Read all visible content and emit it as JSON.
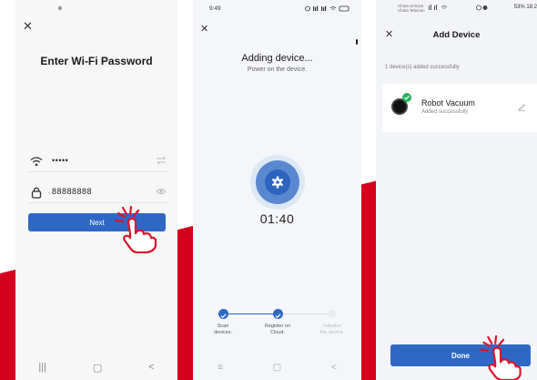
{
  "screen1": {
    "title": "Enter Wi-Fi Password",
    "wifi_value": "•••••",
    "password_value": "88888888",
    "next_label": "Next",
    "nav": [
      "|||",
      "▢",
      "<"
    ]
  },
  "screen2": {
    "time": "9:49",
    "title": "Adding device...",
    "subtitle": "Power on the device.",
    "timer": "01:40",
    "steps": [
      {
        "label_line1": "Scan",
        "label_line2": "devices.",
        "state": "done"
      },
      {
        "label_line1": "Register on",
        "label_line2": "Cloud.",
        "state": "done"
      },
      {
        "label_line1": "Initialize",
        "label_line2": "the device.",
        "state": "pending"
      }
    ],
    "nav": [
      "≡",
      "▢",
      "<"
    ]
  },
  "screen3": {
    "carrier1": "China Unicom",
    "carrier2": "China Telecom",
    "status_right": "53% 18:2",
    "title": "Add Device",
    "added_count": "1 device(s) added successfully",
    "device_name": "Robot Vacuum",
    "device_status": "Added successfully",
    "done_label": "Done"
  },
  "colors": {
    "accent": "#2f68c4",
    "brand_red": "#d4001c",
    "success": "#25b45a"
  }
}
